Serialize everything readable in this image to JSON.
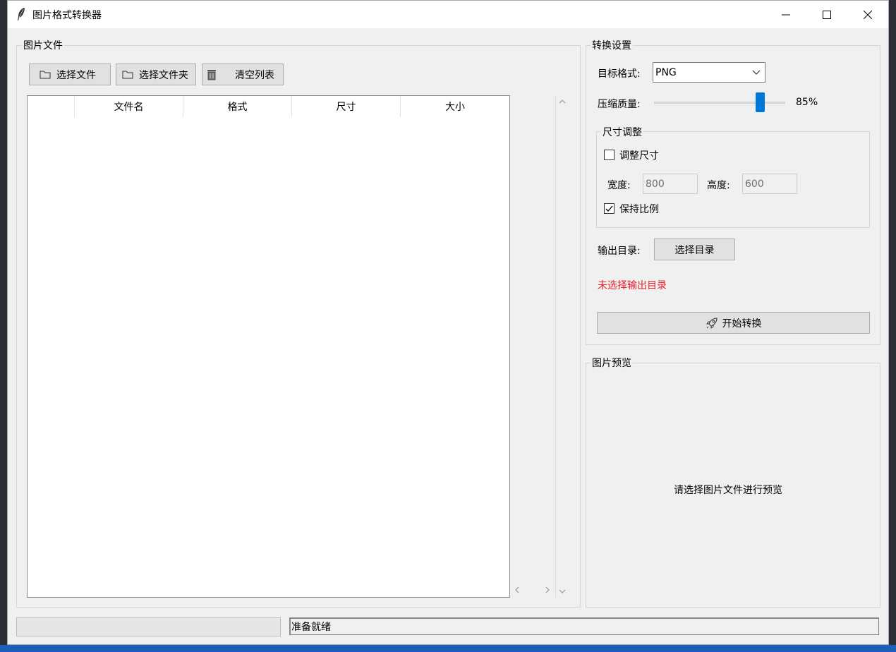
{
  "window": {
    "title": "图片格式转换器"
  },
  "files_panel": {
    "group_label": "图片文件",
    "buttons": {
      "select_files": "选择文件",
      "select_folder": "选择文件夹",
      "clear_list": "清空列表"
    },
    "columns": [
      "",
      "文件名",
      "格式",
      "尺寸",
      "大小"
    ]
  },
  "settings_panel": {
    "group_label": "转换设置",
    "target_format_label": "目标格式:",
    "target_format_value": "PNG",
    "quality_label": "压缩质量:",
    "quality_percent": 85,
    "quality_text": "85%",
    "resize": {
      "group_label": "尺寸调整",
      "resize_checkbox_label": "调整尺寸",
      "resize_checked": false,
      "width_label": "宽度:",
      "width_value": "800",
      "height_label": "高度:",
      "height_value": "600",
      "keep_ratio_label": "保持比例",
      "keep_ratio_checked": true
    },
    "output_dir_label": "输出目录:",
    "choose_dir_button": "选择目录",
    "no_output_dir_warning": "未选择输出目录",
    "start_button": "开始转换"
  },
  "preview_panel": {
    "group_label": "图片预览",
    "placeholder": "请选择图片文件进行预览"
  },
  "status_bar": {
    "progress": 0,
    "message": "准备就绪"
  },
  "colors": {
    "warning": "#e8202a",
    "accent": "#0078d7"
  }
}
